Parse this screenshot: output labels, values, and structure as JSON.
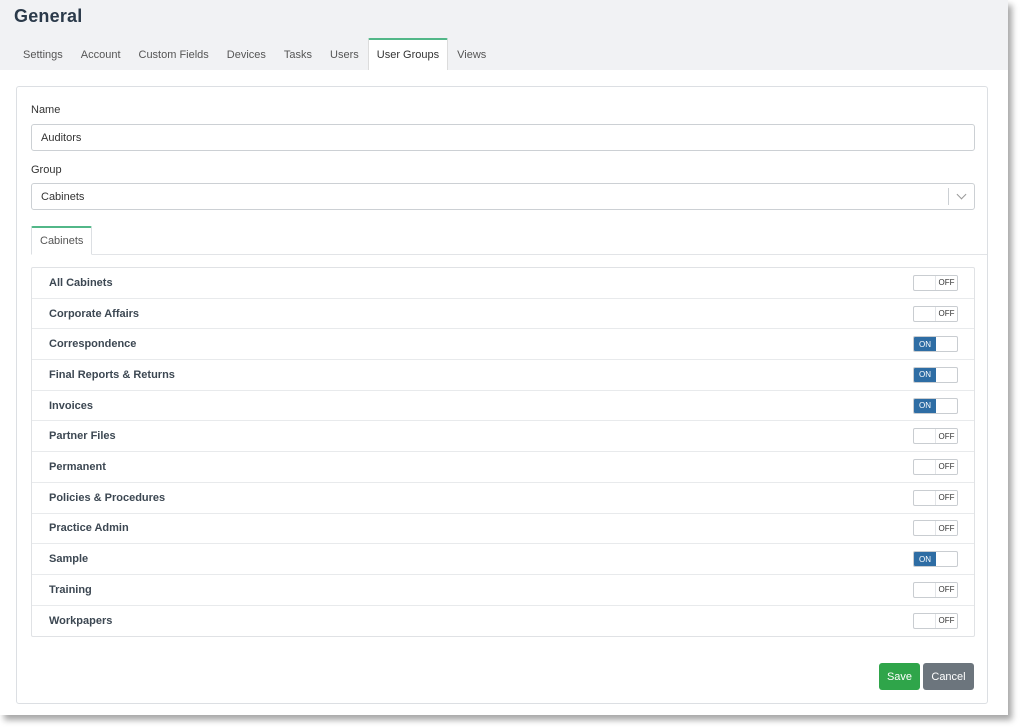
{
  "page": {
    "title": "General"
  },
  "tabs": [
    {
      "label": "Settings"
    },
    {
      "label": "Account"
    },
    {
      "label": "Custom Fields"
    },
    {
      "label": "Devices"
    },
    {
      "label": "Tasks"
    },
    {
      "label": "Users"
    },
    {
      "label": "User Groups",
      "active": true
    },
    {
      "label": "Views"
    }
  ],
  "form": {
    "name_label": "Name",
    "name_value": "Auditors",
    "group_label": "Group",
    "group_value": "Cabinets"
  },
  "subtab": {
    "label": "Cabinets"
  },
  "cabinets": [
    {
      "label": "All Cabinets",
      "state": "OFF"
    },
    {
      "label": "Corporate Affairs",
      "state": "OFF"
    },
    {
      "label": "Correspondence",
      "state": "ON"
    },
    {
      "label": "Final Reports & Returns",
      "state": "ON"
    },
    {
      "label": "Invoices",
      "state": "ON"
    },
    {
      "label": "Partner Files",
      "state": "OFF"
    },
    {
      "label": "Permanent",
      "state": "OFF"
    },
    {
      "label": "Policies & Procedures",
      "state": "OFF"
    },
    {
      "label": "Practice Admin",
      "state": "OFF"
    },
    {
      "label": "Sample",
      "state": "ON"
    },
    {
      "label": "Training",
      "state": "OFF"
    },
    {
      "label": "Workpapers",
      "state": "OFF"
    }
  ],
  "buttons": {
    "save": "Save",
    "cancel": "Cancel"
  },
  "colors": {
    "accent": "#52b788",
    "toggle_on": "#2e6da4",
    "save": "#2fa54a",
    "cancel": "#6c757d"
  }
}
